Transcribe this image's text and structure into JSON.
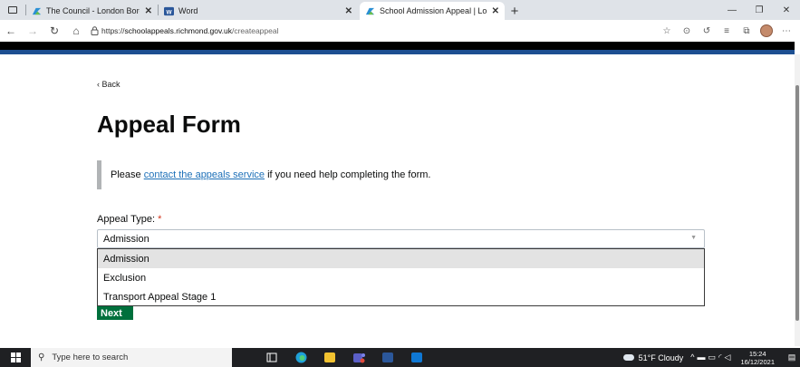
{
  "browser": {
    "tabs": [
      {
        "title": "The Council - London Borough o",
        "active": false
      },
      {
        "title": "Word",
        "active": false
      },
      {
        "title": "School Admission Appeal | Lond",
        "active": true
      }
    ],
    "new_tab": "+",
    "address": {
      "scheme": "https://",
      "host": "schoolappeals.richmond.gov.uk",
      "path": "/createappeal"
    }
  },
  "page": {
    "back_label": "Back",
    "title": "Appeal Form",
    "inset": {
      "before": "Please ",
      "link": "contact the appeals service",
      "after": " if you need help completing the form."
    },
    "appeal_type": {
      "label": "Appeal Type:",
      "required_marker": "*",
      "selected": "Admission",
      "options": [
        "Admission",
        "Exclusion",
        "Transport Appeal Stage 1"
      ],
      "highlighted_index": 0
    },
    "next_label": "Next"
  },
  "taskbar": {
    "search_placeholder": "Type here to search",
    "weather": "51°F  Cloudy",
    "time": "15:24",
    "date": "16/12/2021"
  },
  "colors": {
    "link": "#1d70b8",
    "required": "#d4351c",
    "next_button": "#00703c",
    "header_stripe": "#1d4f91"
  }
}
